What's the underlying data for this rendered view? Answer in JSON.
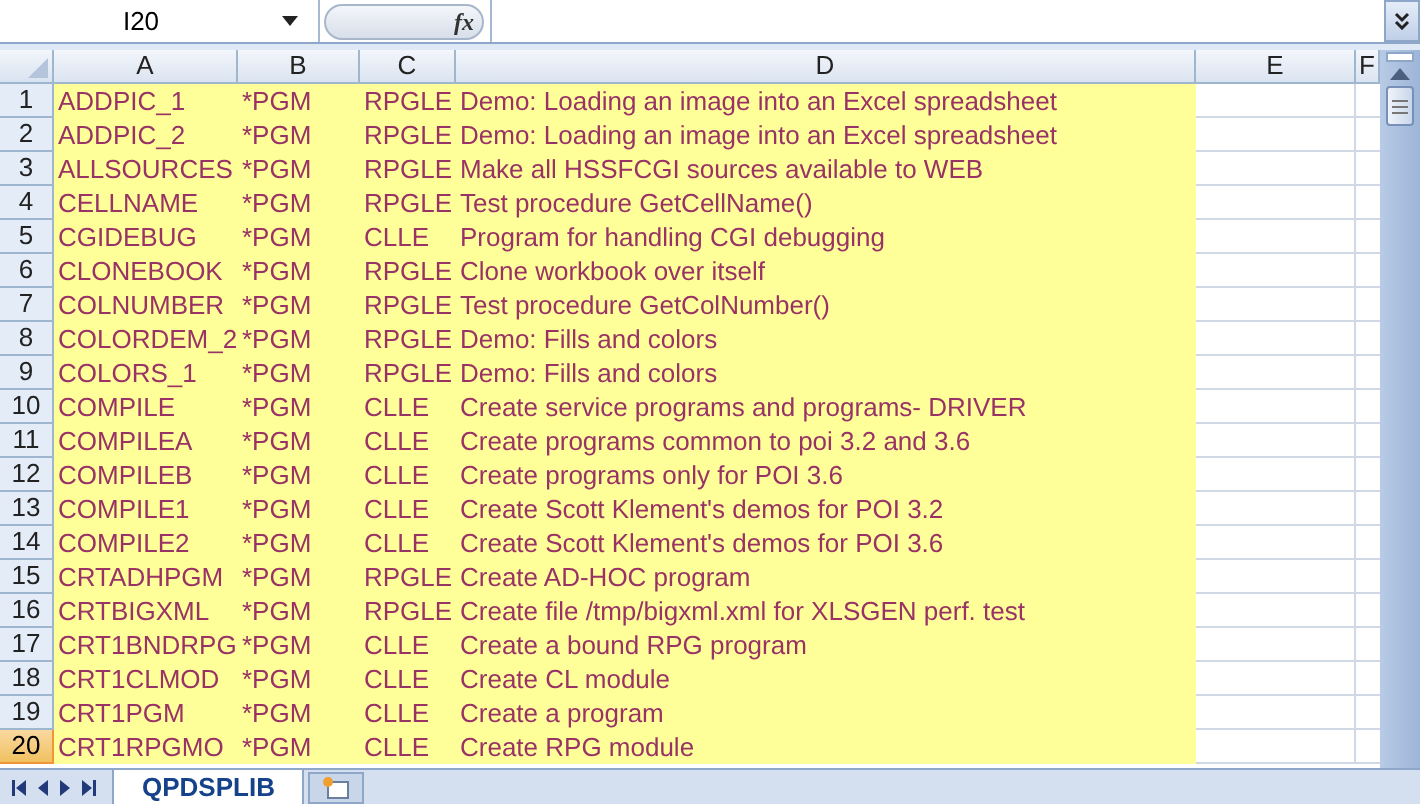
{
  "name_box": {
    "value": "I20"
  },
  "formula_bar": {
    "icon_text": "fx"
  },
  "columns": [
    {
      "label": "A"
    },
    {
      "label": "B"
    },
    {
      "label": "C"
    },
    {
      "label": "D"
    },
    {
      "label": "E"
    },
    {
      "label": "F"
    }
  ],
  "rows": [
    {
      "number": "1",
      "selected": false,
      "cells": [
        "ADDPIC_1",
        "*PGM",
        "RPGLE",
        "Demo: Loading an image into an Excel spreadsheet"
      ]
    },
    {
      "number": "2",
      "selected": false,
      "cells": [
        "ADDPIC_2",
        "*PGM",
        "RPGLE",
        "Demo: Loading an image into an Excel spreadsheet"
      ]
    },
    {
      "number": "3",
      "selected": false,
      "cells": [
        "ALLSOURCES",
        "*PGM",
        "RPGLE",
        "Make all HSSFCGI sources available to WEB"
      ]
    },
    {
      "number": "4",
      "selected": false,
      "cells": [
        "CELLNAME",
        "*PGM",
        "RPGLE",
        "Test procedure GetCellName()"
      ]
    },
    {
      "number": "5",
      "selected": false,
      "cells": [
        "CGIDEBUG",
        "*PGM",
        "CLLE",
        "Program for handling CGI debugging"
      ]
    },
    {
      "number": "6",
      "selected": false,
      "cells": [
        "CLONEBOOK",
        "*PGM",
        "RPGLE",
        "Clone workbook over itself"
      ]
    },
    {
      "number": "7",
      "selected": false,
      "cells": [
        "COLNUMBER",
        "*PGM",
        "RPGLE",
        "Test procedure GetColNumber()"
      ]
    },
    {
      "number": "8",
      "selected": false,
      "cells": [
        "COLORDEM_2",
        "*PGM",
        "RPGLE",
        "Demo: Fills and colors"
      ]
    },
    {
      "number": "9",
      "selected": false,
      "cells": [
        "COLORS_1",
        "*PGM",
        "RPGLE",
        "Demo: Fills and colors"
      ]
    },
    {
      "number": "10",
      "selected": false,
      "cells": [
        "COMPILE",
        "*PGM",
        "CLLE",
        "Create service programs and programs- DRIVER"
      ]
    },
    {
      "number": "11",
      "selected": false,
      "cells": [
        "COMPILEA",
        "*PGM",
        "CLLE",
        "Create programs common to poi 3.2 and 3.6"
      ]
    },
    {
      "number": "12",
      "selected": false,
      "cells": [
        "COMPILEB",
        "*PGM",
        "CLLE",
        "Create programs only for POI 3.6"
      ]
    },
    {
      "number": "13",
      "selected": false,
      "cells": [
        "COMPILE1",
        "*PGM",
        "CLLE",
        "Create Scott Klement's demos for POI 3.2"
      ]
    },
    {
      "number": "14",
      "selected": false,
      "cells": [
        "COMPILE2",
        "*PGM",
        "CLLE",
        "Create Scott Klement's demos for POI 3.6"
      ]
    },
    {
      "number": "15",
      "selected": false,
      "cells": [
        "CRTADHPGM",
        "*PGM",
        "RPGLE",
        "Create AD-HOC program"
      ]
    },
    {
      "number": "16",
      "selected": false,
      "cells": [
        "CRTBIGXML",
        "*PGM",
        "RPGLE",
        "Create file /tmp/bigxml.xml for XLSGEN perf. test"
      ]
    },
    {
      "number": "17",
      "selected": false,
      "cells": [
        "CRT1BNDRPG",
        "*PGM",
        "CLLE",
        "Create a bound RPG program"
      ]
    },
    {
      "number": "18",
      "selected": false,
      "cells": [
        "CRT1CLMOD",
        "*PGM",
        "CLLE",
        "Create CL  module"
      ]
    },
    {
      "number": "19",
      "selected": false,
      "cells": [
        "CRT1PGM",
        "*PGM",
        "CLLE",
        "Create a program"
      ]
    },
    {
      "number": "20",
      "selected": true,
      "cells": [
        "CRT1RPGMO",
        "*PGM",
        "CLLE",
        "Create RPG module"
      ]
    }
  ],
  "sheet_tabs": [
    {
      "label": "QPDSPLIB",
      "selected": true
    }
  ]
}
